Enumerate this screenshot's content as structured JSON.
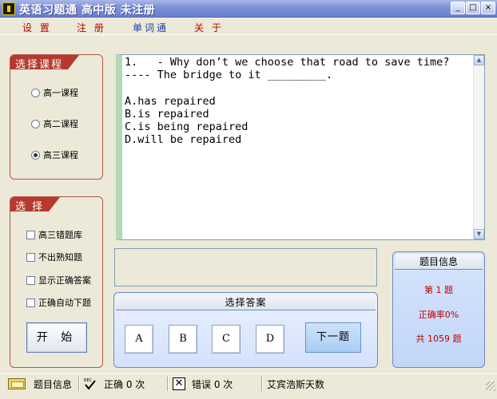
{
  "window": {
    "title": "英语习题通 高中版 未注册",
    "controls": {
      "minimize": "_",
      "maximize": "□",
      "close": "×"
    }
  },
  "menu": [
    "设 置",
    "注 册",
    "单词通",
    "关 于"
  ],
  "course_group": {
    "title": "选择课程",
    "options": [
      {
        "label": "高一课程",
        "selected": false
      },
      {
        "label": "高二课程",
        "selected": false
      },
      {
        "label": "高三课程",
        "selected": true
      }
    ]
  },
  "select_group": {
    "title": "选 择",
    "checkboxes": [
      {
        "label": "高三错题库",
        "checked": false
      },
      {
        "label": "不出熟知题",
        "checked": false
      },
      {
        "label": "显示正确答案",
        "checked": false
      },
      {
        "label": "正确自动下题",
        "checked": false
      }
    ],
    "start_label": "开 始"
  },
  "question": {
    "lines": [
      "1.   - Why don’t we choose that road to save time?",
      "---- The bridge to it _________.",
      "",
      "A.has repaired",
      "B.is repaired",
      "C.is being repaired",
      "D.will be repaired"
    ]
  },
  "answer_panel": {
    "title": "选择答案",
    "options": [
      "A",
      "B",
      "C",
      "D"
    ],
    "next_label": "下一题"
  },
  "info_panel": {
    "title": "题目信息",
    "current": "第  1  题",
    "accuracy": "正确率0%",
    "total": "共  1059  题"
  },
  "statusbar": {
    "info_label": "题目信息",
    "correct_label": "正确 0 次",
    "wrong_label": "错误 0 次",
    "publisher": "艾宾浩斯天数",
    "check_icon_text": "REC"
  }
}
